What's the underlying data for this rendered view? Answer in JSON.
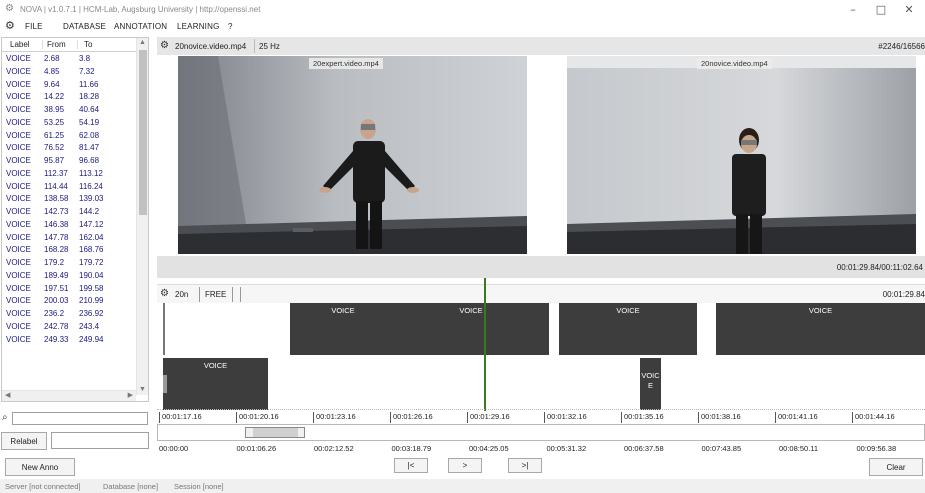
{
  "window": {
    "title": "NOVA | v1.0.7.1 | HCM-Lab, Augsburg University | http://openssi.net",
    "minimize": "–",
    "maximize": "□",
    "close": "✕"
  },
  "menu": {
    "items": [
      "FILE",
      "DATABASE",
      "ANNOTATION",
      "LEARNING",
      "?"
    ]
  },
  "annotation_list": {
    "headers": {
      "label": "Label",
      "from": "From",
      "to": "To"
    },
    "rows": [
      {
        "label": "VOICE",
        "from": "2.68",
        "to": "3.8"
      },
      {
        "label": "VOICE",
        "from": "4.85",
        "to": "7.32"
      },
      {
        "label": "VOICE",
        "from": "9.64",
        "to": "11.66"
      },
      {
        "label": "VOICE",
        "from": "14.22",
        "to": "18.28"
      },
      {
        "label": "VOICE",
        "from": "38.95",
        "to": "40.64"
      },
      {
        "label": "VOICE",
        "from": "53.25",
        "to": "54.19"
      },
      {
        "label": "VOICE",
        "from": "61.25",
        "to": "62.08"
      },
      {
        "label": "VOICE",
        "from": "76.52",
        "to": "81.47"
      },
      {
        "label": "VOICE",
        "from": "95.87",
        "to": "96.68"
      },
      {
        "label": "VOICE",
        "from": "112.37",
        "to": "113.12"
      },
      {
        "label": "VOICE",
        "from": "114.44",
        "to": "116.24"
      },
      {
        "label": "VOICE",
        "from": "138.58",
        "to": "139.03"
      },
      {
        "label": "VOICE",
        "from": "142.73",
        "to": "144.2"
      },
      {
        "label": "VOICE",
        "from": "146.38",
        "to": "147.12"
      },
      {
        "label": "VOICE",
        "from": "147.78",
        "to": "162.04"
      },
      {
        "label": "VOICE",
        "from": "168.28",
        "to": "168.76"
      },
      {
        "label": "VOICE",
        "from": "179.2",
        "to": "179.72"
      },
      {
        "label": "VOICE",
        "from": "189.49",
        "to": "190.04"
      },
      {
        "label": "VOICE",
        "from": "197.51",
        "to": "199.58"
      },
      {
        "label": "VOICE",
        "from": "200.03",
        "to": "210.99"
      },
      {
        "label": "VOICE",
        "from": "236.2",
        "to": "236.92"
      },
      {
        "label": "VOICE",
        "from": "242.78",
        "to": "243.4"
      },
      {
        "label": "VOICE",
        "from": "249.33",
        "to": "249.94"
      }
    ]
  },
  "search": {
    "value": ""
  },
  "relabel": {
    "button": "Relabel",
    "value": ""
  },
  "new_anno": {
    "button": "New Anno"
  },
  "media": {
    "file": "20novice.video.mp4",
    "rate": "25 Hz",
    "frame_counter": "#2246/16566",
    "videos": [
      {
        "label": "20expert.video.mp4"
      },
      {
        "label": "20novice.video.mp4"
      }
    ],
    "position": "00:01:29.84/00:11:02.64",
    "progress_fraction": 0.136
  },
  "annotation_track": {
    "tier": "20n",
    "mode": "FREE",
    "time": "00:01:29.84",
    "segments": [
      {
        "label": "VOICE"
      },
      {
        "label": "VOICE"
      },
      {
        "label": "VOICE"
      },
      {
        "label": "VOICE"
      },
      {
        "label": "VOICE"
      },
      {
        "label": "VOIC\nE"
      }
    ]
  },
  "ruler": {
    "ticks": [
      "00:01:17.16",
      "00:01:20.16",
      "00:01:23.16",
      "00:01:26.16",
      "00:01:29.16",
      "00:01:32.16",
      "00:01:35.16",
      "00:01:38.16",
      "00:01:41.16",
      "00:01:44.16"
    ]
  },
  "overview": {
    "ticks": [
      "00:00:00",
      "00:01:06.26",
      "00:02:12.52",
      "00:03:18.79",
      "00:04:25.05",
      "00:05:31.32",
      "00:06:37.58",
      "00:07:43.85",
      "00:08:50.11",
      "00:09:56.38"
    ]
  },
  "playback": {
    "start": "|<",
    "play": ">",
    "end": ">|"
  },
  "clear": {
    "button": "Clear"
  },
  "status": {
    "server": "Server [not connected]",
    "database": "Database [none]",
    "session": "Session [none]"
  }
}
